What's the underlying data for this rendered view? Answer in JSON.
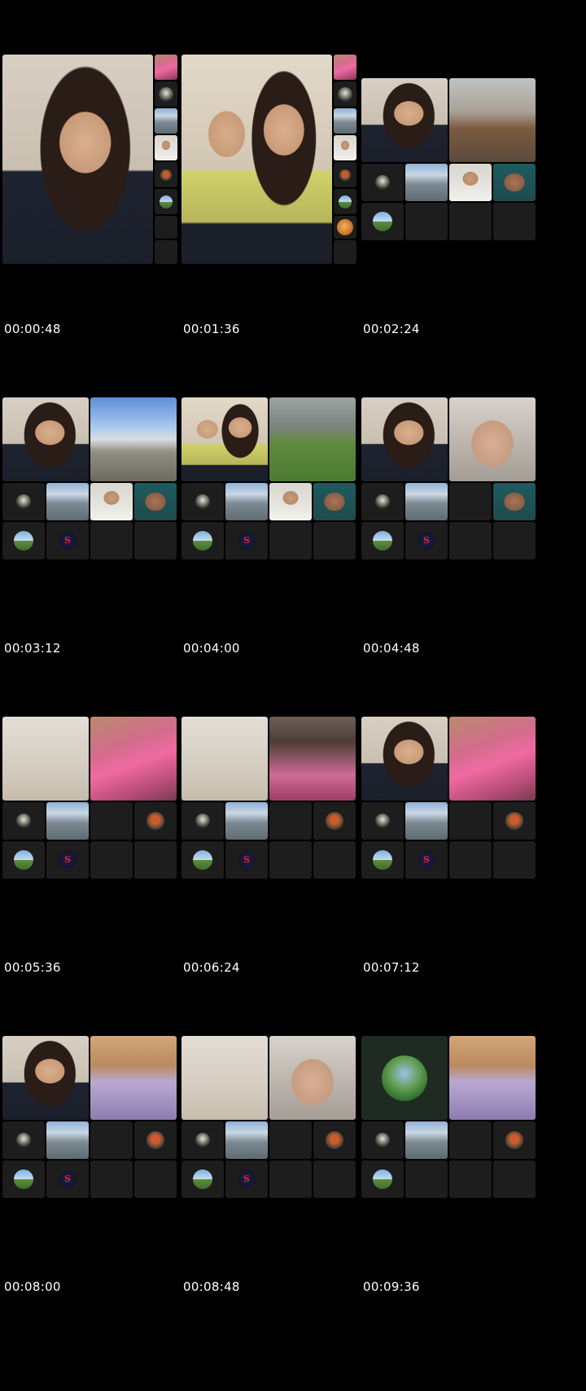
{
  "timestamps": [
    "00:00:48",
    "00:01:36",
    "00:02:24",
    "00:03:12",
    "00:04:00",
    "00:04:48",
    "00:05:36",
    "00:06:24",
    "00:07:12",
    "00:08:00",
    "00:08:48",
    "00:09:36"
  ],
  "colors": {
    "background": "#000000",
    "tile": "#1c1d1c",
    "text": "#ffffff",
    "superman_logo": "#d82a2a"
  },
  "icons": {
    "superman": "S"
  }
}
